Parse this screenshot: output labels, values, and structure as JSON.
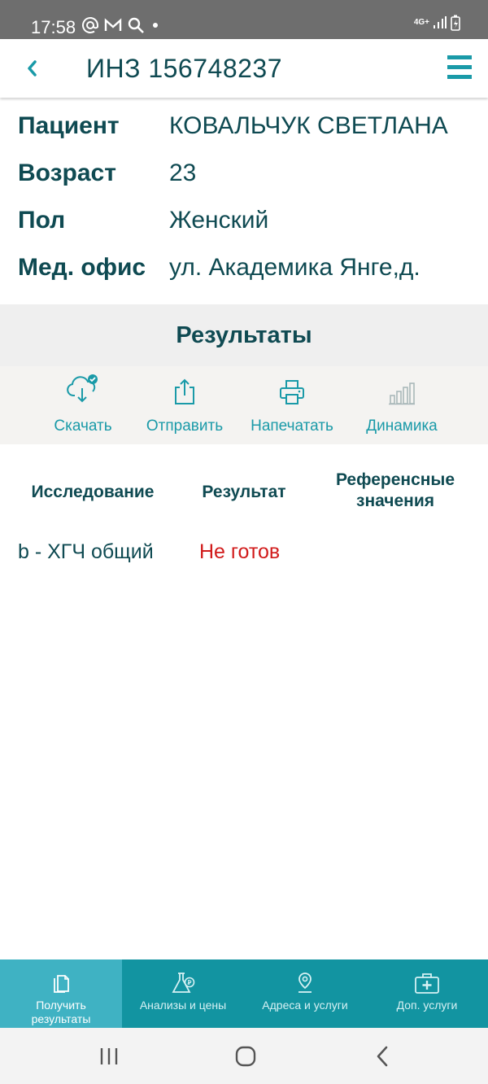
{
  "status_bar": {
    "time": "17:58",
    "network": "4G+"
  },
  "app_bar": {
    "title": "ИНЗ 156748237"
  },
  "patient": {
    "rows": [
      {
        "label": "Пациент",
        "value": "КОВАЛЬЧУК СВЕТЛАНА"
      },
      {
        "label": "Возраст",
        "value": "23"
      },
      {
        "label": "Пол",
        "value": "Женский"
      },
      {
        "label": "Мед. офис",
        "value": "ул. Академика Янге,д."
      }
    ]
  },
  "results": {
    "title": "Результаты",
    "actions": [
      {
        "label": "Скачать",
        "icon": "cloud-download-icon"
      },
      {
        "label": "Отправить",
        "icon": "share-icon"
      },
      {
        "label": "Напечатать",
        "icon": "printer-icon"
      },
      {
        "label": "Динамика",
        "icon": "bar-chart-icon"
      }
    ]
  },
  "table": {
    "headers": {
      "study": "Исследование",
      "result": "Результат",
      "reference_line1": "Референсные",
      "reference_line2": "значения"
    },
    "rows": [
      {
        "study": "b - ХГЧ общий",
        "result": "Не готов"
      }
    ]
  },
  "bottom_nav": {
    "items": [
      {
        "label_line1": "Получить",
        "label_line2": "результаты",
        "icon": "document-icon",
        "active": true
      },
      {
        "label_line1": "Анализы и цены",
        "label_line2": "",
        "icon": "flask-icon",
        "active": false
      },
      {
        "label_line1": "Адреса и услуги",
        "label_line2": "",
        "icon": "location-pin-icon",
        "active": false
      },
      {
        "label_line1": "Доп. услуги",
        "label_line2": "",
        "icon": "medical-kit-icon",
        "active": false
      }
    ]
  },
  "colors": {
    "accent": "#1a9aa8",
    "nav_bg": "#1294a1",
    "nav_active": "#3fb2c3",
    "text_dark": "#0f4a52",
    "status_not_ready": "#d11b1b"
  }
}
